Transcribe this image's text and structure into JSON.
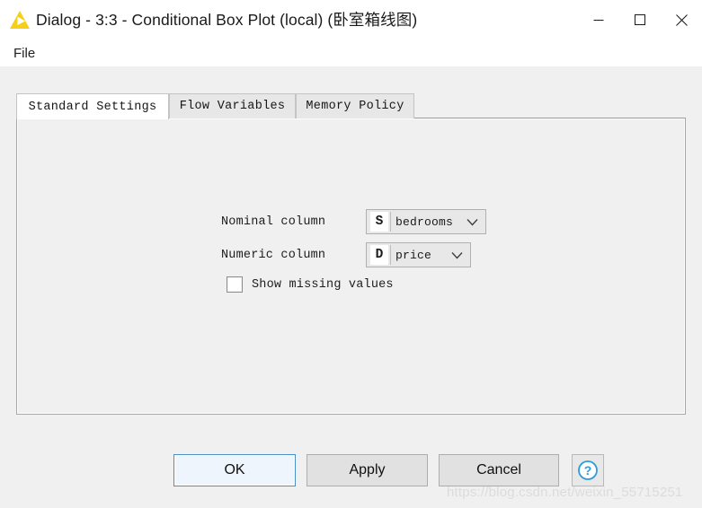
{
  "window": {
    "title": "Dialog - 3:3 - Conditional Box Plot (local) (卧室箱线图)",
    "icon": "knime-triangle-icon",
    "controls": {
      "minimize": "minimize-icon",
      "maximize": "maximize-icon",
      "close": "close-icon"
    }
  },
  "menubar": {
    "items": [
      {
        "label": "File"
      }
    ]
  },
  "tabs": [
    {
      "label": "Standard Settings",
      "active": true
    },
    {
      "label": "Flow Variables",
      "active": false
    },
    {
      "label": "Memory Policy",
      "active": false
    }
  ],
  "form": {
    "nominal": {
      "label": "Nominal column",
      "badge": "S",
      "badge_name": "string-type-icon",
      "value": "bedrooms"
    },
    "numeric": {
      "label": "Numeric column",
      "badge": "D",
      "badge_name": "double-type-icon",
      "value": "price"
    },
    "show_missing": {
      "label": "Show missing values",
      "checked": false
    }
  },
  "footer": {
    "ok": "OK",
    "apply": "Apply",
    "cancel": "Cancel",
    "help": "help-icon"
  },
  "watermark": "https://blog.csdn.net/weixin_55715251",
  "colors": {
    "accent": "#0078d7",
    "focus_border": "#4a90c8",
    "focus_fill": "#eef5fc",
    "window_bg": "#f0f0f0",
    "titlebar_bg": "#ffffff",
    "logo_yellow": "#f5cf18",
    "help_blue": "#2e9bdc"
  }
}
